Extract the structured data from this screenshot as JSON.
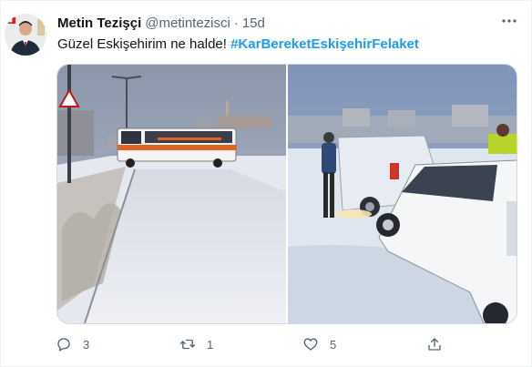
{
  "author": {
    "name": "Metin Tezişçi",
    "handle": "@metintezisci",
    "separator": "·",
    "time": "15d"
  },
  "tweet": {
    "text": "Güzel Eskişehirim ne halde!",
    "hashtag": "#KarBereketEskişehirFelaket"
  },
  "media": [
    {
      "icon": "snowy-bus-photo"
    },
    {
      "icon": "snowy-cars-photo"
    }
  ],
  "actions": {
    "reply_count": "3",
    "retweet_count": "1",
    "like_count": "5"
  },
  "colors": {
    "accent": "#1d9bf0",
    "secondary_text": "#536471"
  }
}
